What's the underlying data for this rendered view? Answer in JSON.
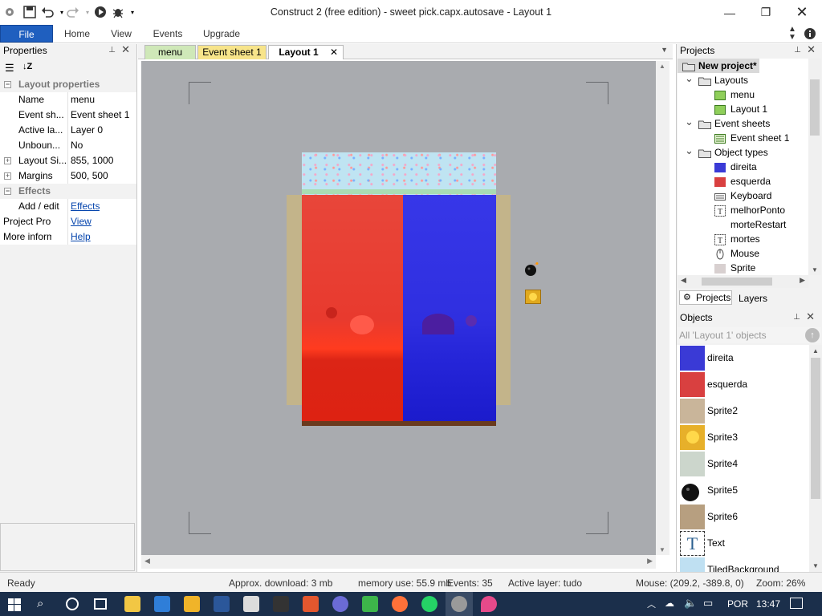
{
  "window": {
    "title": "Construct 2  (free edition) - sweet pick.capx.autosave - Layout 1"
  },
  "ribbon": {
    "tabs": [
      "File",
      "Home",
      "View",
      "Events",
      "Upgrade"
    ]
  },
  "properties_panel": {
    "title": "Properties",
    "rows": [
      {
        "type": "category",
        "key": "Layout properties"
      },
      {
        "key": "Name",
        "value": "menu"
      },
      {
        "key": "Event sh...",
        "value": "Event sheet 1"
      },
      {
        "key": "Active la...",
        "value": "Layer 0"
      },
      {
        "key": "Unboun...",
        "value": "No"
      },
      {
        "key": "Layout Si...",
        "value": "855, 1000",
        "expandable": true
      },
      {
        "key": "Margins",
        "value": "500, 500",
        "expandable": true
      },
      {
        "type": "category",
        "key": "Effects"
      },
      {
        "key": "Add / edit",
        "value": "Effects",
        "link": true
      },
      {
        "key": "Project Prop...",
        "value": "View",
        "link": true,
        "top": true
      },
      {
        "key": "More inform...",
        "value": "Help",
        "link": true,
        "top": true
      }
    ]
  },
  "doc_tabs": [
    {
      "label": "menu",
      "color": "#cfe8b8"
    },
    {
      "label": "Event sheet 1",
      "color": "#f7e48a"
    },
    {
      "label": "Layout 1",
      "color": "#dfe7f3",
      "active": true,
      "closable": true
    }
  ],
  "projects_panel": {
    "title": "Projects",
    "tree": [
      {
        "label": "New project*",
        "level": 0,
        "icon": "folder-icon",
        "bold": true
      },
      {
        "label": "Layouts",
        "level": 1,
        "icon": "folder-icon"
      },
      {
        "label": "menu",
        "level": 2,
        "icon": "layout-icon"
      },
      {
        "label": "Layout 1",
        "level": 2,
        "icon": "layout-icon"
      },
      {
        "label": "Event sheets",
        "level": 1,
        "icon": "folder-icon"
      },
      {
        "label": "Event sheet 1",
        "level": 2,
        "icon": "eventsheet-icon"
      },
      {
        "label": "Object types",
        "level": 1,
        "icon": "folder-icon"
      },
      {
        "label": "direita",
        "level": 2,
        "icon": "blue-swatch-icon"
      },
      {
        "label": "esquerda",
        "level": 2,
        "icon": "red-swatch-icon"
      },
      {
        "label": "Keyboard",
        "level": 2,
        "icon": "keyboard-icon"
      },
      {
        "label": "melhorPonto",
        "level": 2,
        "icon": "text-icon"
      },
      {
        "label": "morteRestart",
        "level": 2,
        "icon": "none"
      },
      {
        "label": "mortes",
        "level": 2,
        "icon": "text-icon"
      },
      {
        "label": "Mouse",
        "level": 2,
        "icon": "mouse-icon"
      },
      {
        "label": "Sprite",
        "level": 2,
        "icon": "sprite-icon"
      }
    ],
    "bottom_tabs": [
      "Projects",
      "Layers"
    ]
  },
  "objects_panel": {
    "title": "Objects",
    "filter": "All 'Layout 1' objects",
    "items": [
      {
        "name": "direita",
        "color": "#3a3ad6"
      },
      {
        "name": "esquerda",
        "color": "#d94040"
      },
      {
        "name": "Sprite2",
        "color": "#c9b59a"
      },
      {
        "name": "Sprite3",
        "color": "#e7b02a"
      },
      {
        "name": "Sprite4",
        "color": "#ccd6cc"
      },
      {
        "name": "Sprite5",
        "color": "#111111"
      },
      {
        "name": "Sprite6",
        "color": "#b79f80"
      },
      {
        "name": "Text",
        "color": "#ffffff"
      },
      {
        "name": "TiledBackground",
        "color": "#bfe0f2"
      }
    ]
  },
  "status": {
    "ready": "Ready",
    "download": "Approx. download: 3 mb",
    "memory": "memory use: 55.9 mb",
    "events": "Events: 35",
    "active_layer": "Active layer: tudo",
    "mouse": "Mouse: (209.2, -389.8, 0)",
    "zoom": "Zoom: 26%"
  },
  "taskbar": {
    "lang": "POR",
    "time": "13:47"
  },
  "colors": {
    "accent": "#1f5fbf",
    "canvas": "#a9abaf",
    "red_half": "#e83a2e",
    "blue_half": "#2f2fe0"
  }
}
